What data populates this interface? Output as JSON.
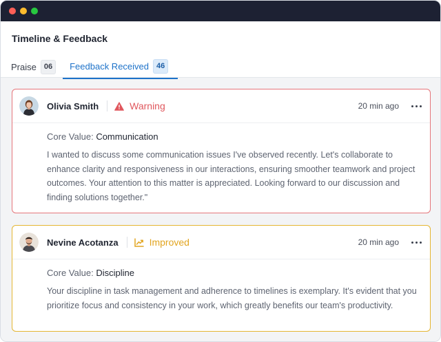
{
  "page": {
    "title": "Timeline & Feedback"
  },
  "tabs": [
    {
      "label": "Praise",
      "count": "06",
      "active": false
    },
    {
      "label": "Feedback Received",
      "count": "46",
      "active": true
    }
  ],
  "feedback": [
    {
      "user": "Olivia Smith",
      "status": "Warning",
      "status_icon": "warning-triangle-icon",
      "time": "20 min ago",
      "core_label": "Core Value:",
      "core_value": "Communication",
      "message": "I wanted to discuss some communication issues I've observed recently. Let's collaborate to enhance clarity and responsiveness in our interactions, ensuring smoother teamwork and project outcomes. Your attention to this matter is appreciated. Looking forward to our discussion and finding solutions together.\"",
      "accent_color": "#e5757a"
    },
    {
      "user": "Nevine Acotanza",
      "status": "Improved",
      "status_icon": "trend-up-chart-icon",
      "time": "20 min ago",
      "core_label": "Core Value:",
      "core_value": "Discipline",
      "message": "Your discipline in task management and adherence to timelines is exemplary. It's evident that you prioritize focus and consistency in your work, which greatly benefits our team's productivity.",
      "accent_color": "#e4b531"
    }
  ],
  "colors": {
    "titlebar": "#1d2133",
    "active_tab": "#1d72c9",
    "warning": "#e0575d",
    "improved": "#e2a521"
  }
}
